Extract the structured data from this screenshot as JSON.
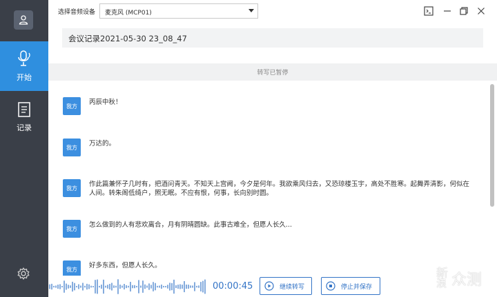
{
  "sidebar": {
    "items": [
      {
        "label": "开始"
      },
      {
        "label": "记录"
      }
    ]
  },
  "header": {
    "device_label": "选择音频设备",
    "device_value": "麦克风 (MCP01)"
  },
  "meeting_title": "会议记录2021-05-30 23_08_47",
  "status": "转写已暂停",
  "messages": [
    {
      "speaker": "我方",
      "text": "丙辰中秋！"
    },
    {
      "speaker": "我方",
      "text": "万达的。"
    },
    {
      "speaker": "我方",
      "text": "作此篇兼怀子几时有，把酒问青天。不知天上宫阙，今夕是何年。我欲乘风归去，又恐琼楼玉宇，高处不胜寒。起舞弄清影，何似在人间。转朱阁低绮户，照无眠。不应有恨，何事，长向别时圆。"
    },
    {
      "speaker": "我方",
      "text": "怎么做到的人有悲欢离合，月有阴晴圆缺。此事古难全，但愿人长久..."
    },
    {
      "speaker": "我方",
      "text": "好多东西，但愿人长久。"
    }
  ],
  "footer": {
    "timer": "00:00:45",
    "continue_label": "继续转写",
    "stop_label": "停止并保存"
  },
  "watermark": {
    "line1": "新",
    "line2": "浪",
    "mark": "众测"
  },
  "colors": {
    "sidebar": "#3a3f48",
    "accent": "#2f8fdf",
    "primary_blue": "#3273c6"
  }
}
